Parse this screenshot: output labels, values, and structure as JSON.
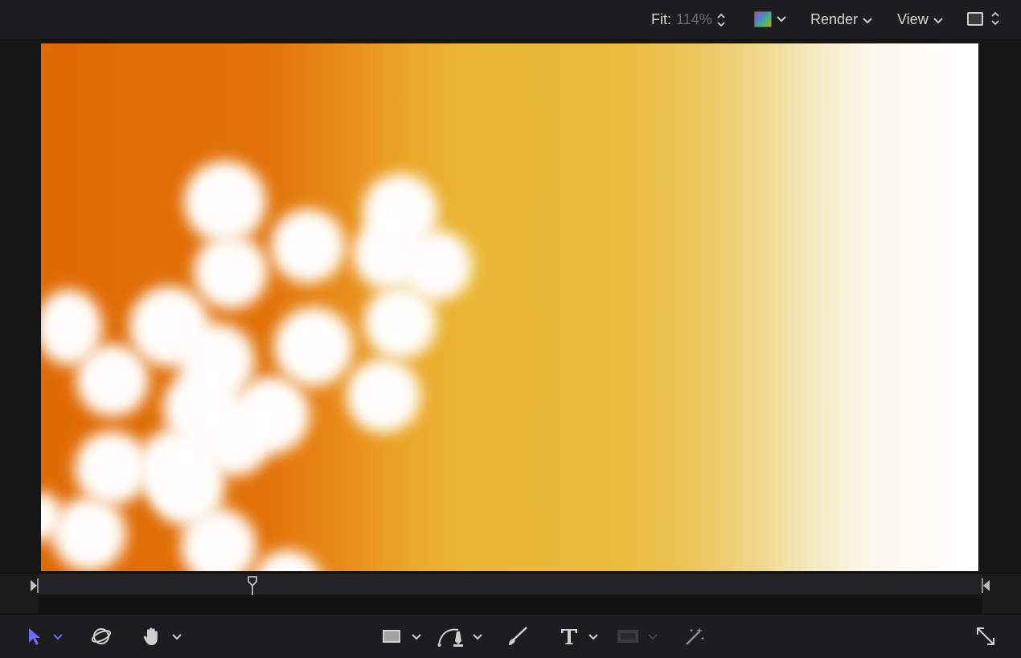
{
  "header": {
    "fit_label": "Fit:",
    "fit_value": "114%",
    "render_label": "Render",
    "view_label": "View"
  },
  "icons": {
    "color_channels": "color-channels-icon",
    "layout": "layout-icon",
    "select_tool": "arrow-pointer-icon",
    "orbit_tool": "orbit-3d-icon",
    "pan_tool": "hand-icon",
    "shape_tool": "rectangle-icon",
    "pen_tool": "bezier-pen-icon",
    "paint_tool": "paint-brush-icon",
    "text_tool": "text-t-icon",
    "mask_tool": "mask-rectangle-icon",
    "wand_tool": "magic-wand-icon",
    "fullscreen": "expand-arrows-icon"
  },
  "colors": {
    "accent": "#6e6cf2",
    "canvas_orange": "#e06a05",
    "canvas_yellow": "#ebbb3c",
    "canvas_white": "#ffffff"
  }
}
